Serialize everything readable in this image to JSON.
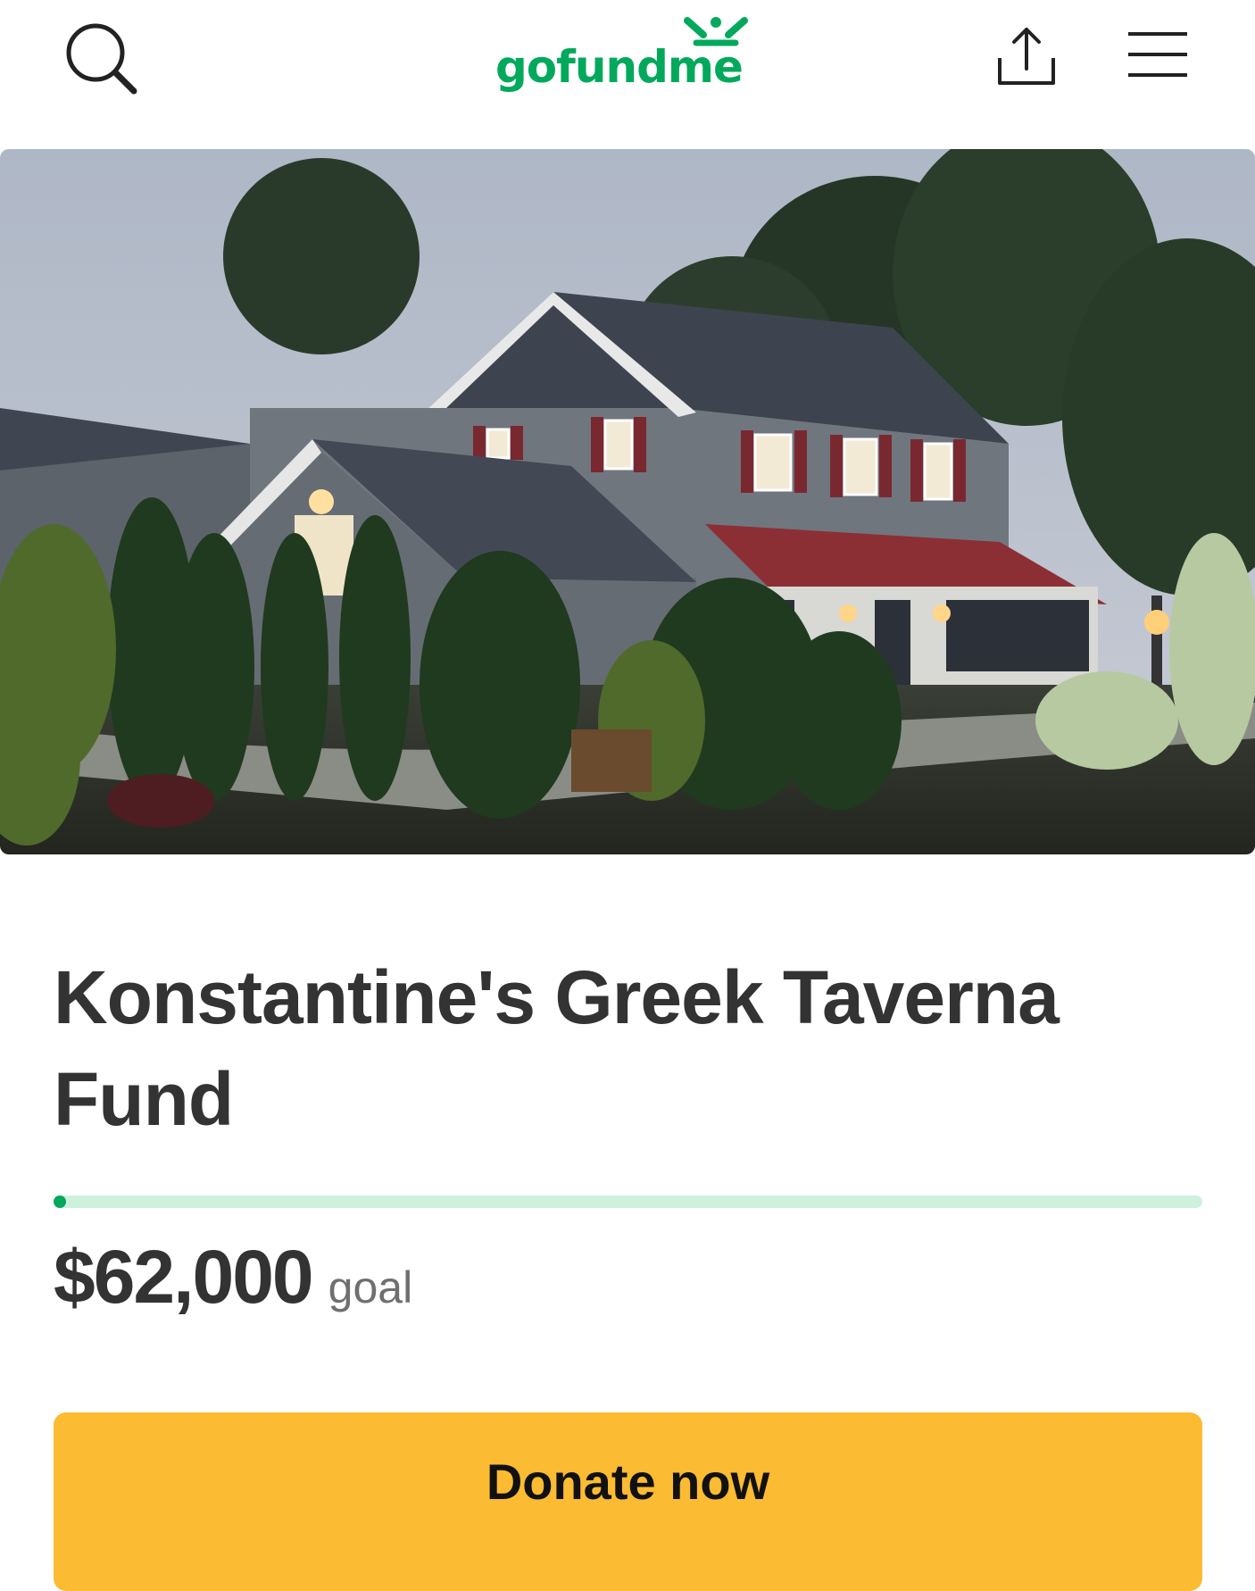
{
  "header": {
    "logo_text": "gofundme",
    "search_icon": "search-icon",
    "share_icon": "share-icon",
    "menu_icon": "hamburger-menu-icon"
  },
  "campaign": {
    "title": "Konstantine's Greek Taverna Fund",
    "hero_image": "exterior photo of restaurant building at dusk",
    "progress_fraction": 0.0,
    "goal_amount": "$62,000",
    "goal_label": "goal"
  },
  "actions": {
    "donate_label": "Donate now"
  },
  "colors": {
    "brand_green": "#02a95c",
    "progress_track": "#cdf1dc",
    "donate_button": "#fbbb32",
    "text_dark": "#333333"
  }
}
